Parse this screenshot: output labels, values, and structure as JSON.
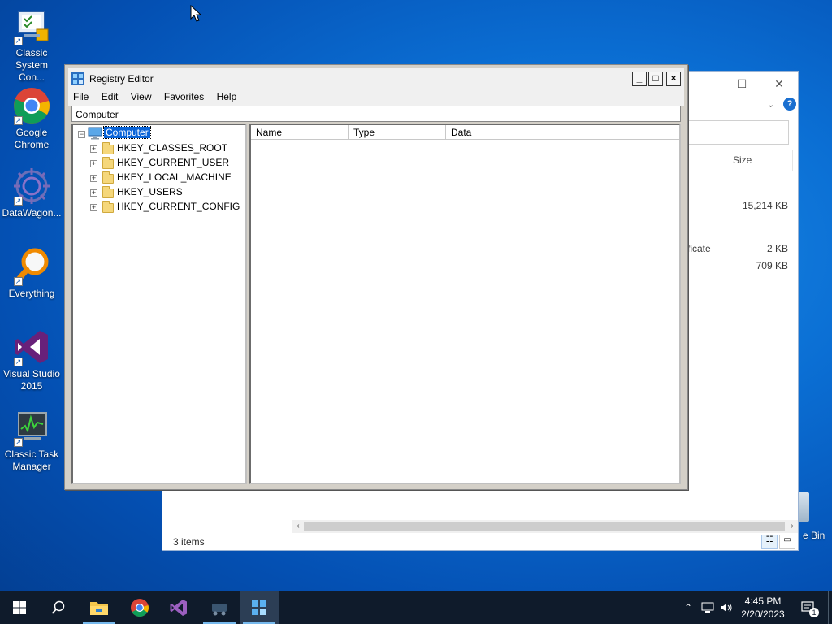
{
  "desktop": {
    "icons": [
      {
        "label": "Classic System Con..."
      },
      {
        "label": "Google Chrome"
      },
      {
        "label": "DataWagon..."
      },
      {
        "label": "Everything"
      },
      {
        "label": "Visual Studio 2015"
      },
      {
        "label": "Classic Task Manager"
      }
    ],
    "recycle_bin_fragment": "e Bin"
  },
  "explorer_bg": {
    "column_size": "Size",
    "rows": [
      {
        "type_fragment": "",
        "size": "15,214 KB"
      },
      {
        "type_fragment": "tificate",
        "size": "2 KB"
      },
      {
        "type_fragment": "",
        "size": "709 KB"
      }
    ],
    "status": "3 items"
  },
  "regedit": {
    "title": "Registry Editor",
    "menu": [
      "File",
      "Edit",
      "View",
      "Favorites",
      "Help"
    ],
    "address": "Computer",
    "tree": {
      "root": "Computer",
      "hives": [
        "HKEY_CLASSES_ROOT",
        "HKEY_CURRENT_USER",
        "HKEY_LOCAL_MACHINE",
        "HKEY_USERS",
        "HKEY_CURRENT_CONFIG"
      ]
    },
    "columns": [
      "Name",
      "Type",
      "Data"
    ],
    "window_buttons": {
      "minimize": "_",
      "maximize": "□",
      "close": "×"
    }
  },
  "taskbar": {
    "clock_time": "4:45 PM",
    "clock_date": "2/20/2023",
    "notification_count": "1"
  },
  "colors": {
    "desktop_blue": "#0b6fd4",
    "taskbar": "#0f1b2b",
    "selection": "#0a64d8"
  }
}
